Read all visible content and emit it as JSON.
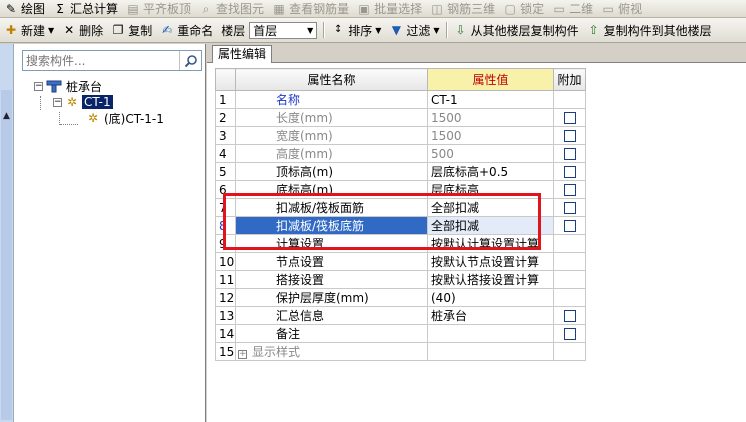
{
  "toolbar1": {
    "items": [
      "绘图",
      "汇总计算",
      "平齐板顶",
      "查找图元",
      "查看钢筋量",
      "批量选择",
      "钢筋三维",
      "锁定",
      "二维",
      "俯视"
    ]
  },
  "toolbar2": {
    "new_label": "新建",
    "delete_label": "删除",
    "copy_label": "复制",
    "rename_label": "重命名",
    "floor_label": "楼层",
    "floor_value": "首层",
    "sort_label": "排序",
    "filter_label": "过滤",
    "copy_from_label": "从其他楼层复制构件",
    "copy_to_label": "复制构件到其他楼层"
  },
  "search": {
    "placeholder": "搜索构件..."
  },
  "tree": {
    "root": "桩承台",
    "child": "CT-1",
    "leaf": "(底)CT-1-1"
  },
  "panel": {
    "tab": "属性编辑",
    "headers": {
      "name": "属性名称",
      "value": "属性值",
      "extra": "附加"
    },
    "rows": [
      {
        "n": "1",
        "name": "名称",
        "value": "CT-1",
        "style": "blue",
        "chk": false
      },
      {
        "n": "2",
        "name": "长度(mm)",
        "value": "1500",
        "style": "gray",
        "chk": true
      },
      {
        "n": "3",
        "name": "宽度(mm)",
        "value": "1500",
        "style": "gray",
        "chk": true
      },
      {
        "n": "4",
        "name": "高度(mm)",
        "value": "500",
        "style": "gray",
        "chk": true
      },
      {
        "n": "5",
        "name": "顶标高(m)",
        "value": "层底标高+0.5",
        "style": "",
        "chk": true
      },
      {
        "n": "6",
        "name": "底标高(m)",
        "value": "层底标高",
        "style": "",
        "chk": true
      },
      {
        "n": "7",
        "name": "扣减板/筏板面筋",
        "value": "全部扣减",
        "style": "",
        "chk": true
      },
      {
        "n": "8",
        "name": "扣减板/筏板底筋",
        "value": "全部扣减",
        "style": "sel",
        "chk": true
      },
      {
        "n": "9",
        "name": "计算设置",
        "value": "按默认计算设置计算",
        "style": "",
        "chk": false
      },
      {
        "n": "10",
        "name": "节点设置",
        "value": "按默认节点设置计算",
        "style": "",
        "chk": false
      },
      {
        "n": "11",
        "name": "搭接设置",
        "value": "按默认搭接设置计算",
        "style": "",
        "chk": false
      },
      {
        "n": "12",
        "name": "保护层厚度(mm)",
        "value": "(40)",
        "style": "",
        "chk": false
      },
      {
        "n": "13",
        "name": "汇总信息",
        "value": "桩承台",
        "style": "",
        "chk": true
      },
      {
        "n": "14",
        "name": "备注",
        "value": "",
        "style": "",
        "chk": true
      },
      {
        "n": "15",
        "name": "显示样式",
        "value": "",
        "style": "group",
        "chk": false
      }
    ]
  }
}
